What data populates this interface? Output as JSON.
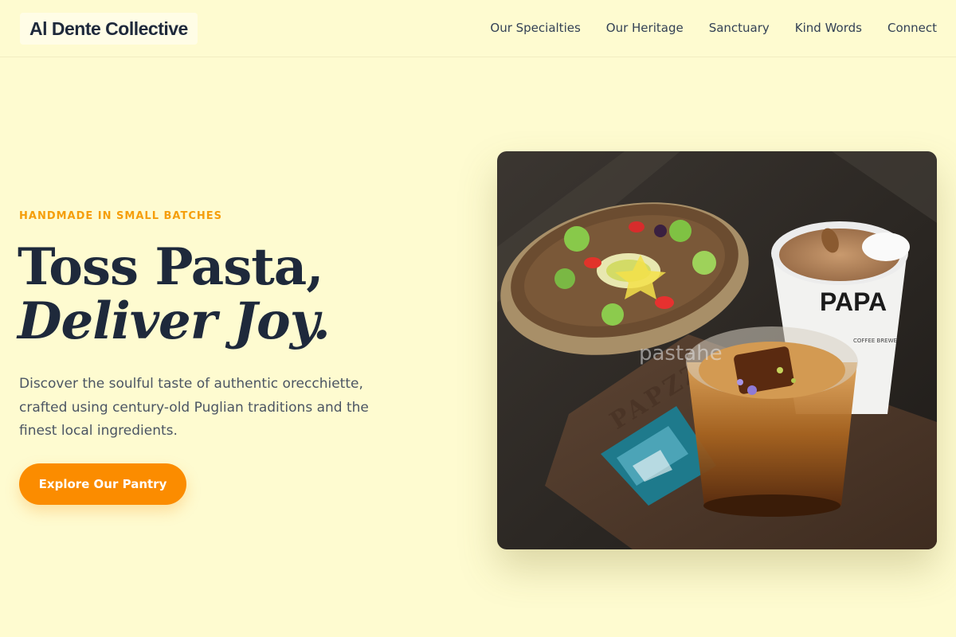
{
  "header": {
    "logo_text": "Al Dente Collective",
    "nav": [
      {
        "label": "Our Specialties"
      },
      {
        "label": "Our Heritage"
      },
      {
        "label": "Sanctuary"
      },
      {
        "label": "Kind Words"
      },
      {
        "label": "Connect"
      }
    ]
  },
  "hero": {
    "eyebrow": "HANDMADE IN SMALL BATCHES",
    "headline_line1": "Toss Pasta,",
    "headline_line2": "Deliver Joy.",
    "description": "Discover the soulful taste of authentic orecchiette, crafted using century-old Puglian traditions and the finest local ingredients.",
    "cta_label": "Explore Our Pantry"
  },
  "photo": {
    "watermark": "pastahe",
    "cup_text": "PAPA",
    "cup_small_text": "COFFEE BREWE",
    "tray_text": "PAPZZ"
  },
  "colors": {
    "background": "#fefbd0",
    "accent": "#fb8c00",
    "eyebrow": "#f59e0b",
    "heading": "#1e293b"
  }
}
